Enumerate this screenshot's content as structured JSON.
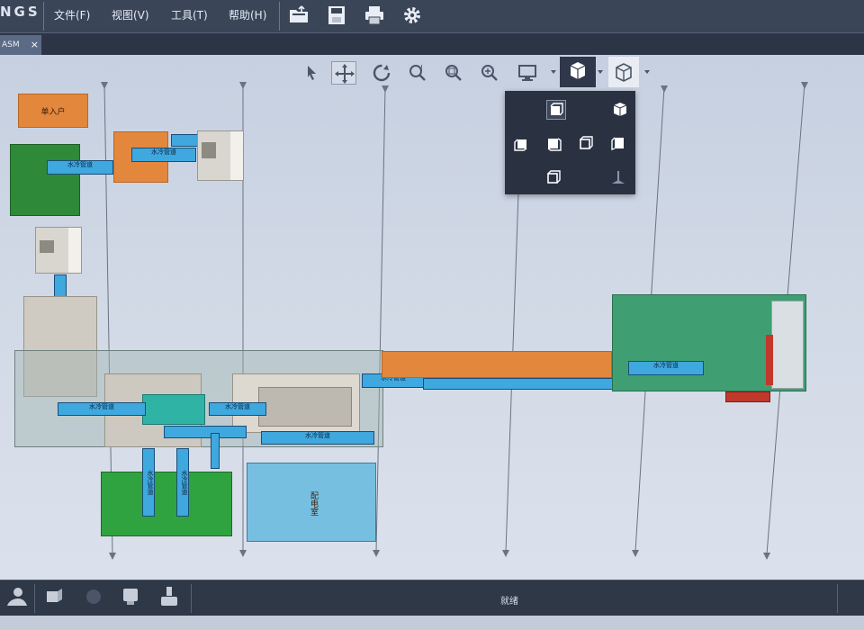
{
  "app": {
    "brand": "NGS"
  },
  "menu": {
    "items": [
      {
        "id": "file",
        "label": "文件(F)"
      },
      {
        "id": "view",
        "label": "视图(V)"
      },
      {
        "id": "tools",
        "label": "工具(T)"
      },
      {
        "id": "help",
        "label": "帮助(H)"
      }
    ]
  },
  "toolbar": {
    "icons": [
      "open-folder-icon",
      "save-icon",
      "print-icon",
      "settings-gear-icon"
    ]
  },
  "tabs": [
    {
      "label": "ASM",
      "close": "×"
    }
  ],
  "view_toolbar": {
    "icons": [
      "select-arrow-icon",
      "pan-move-icon",
      "rotate-icon",
      "zoom-window-icon",
      "zoom-fit-icon",
      "zoom-in-icon",
      "display-monitor-icon",
      "view-orientation-cube-icon",
      "view-style-cube-icon"
    ],
    "active": "pan-move-icon",
    "open_dropdown": "view-orientation-cube-icon"
  },
  "view_popup": {
    "items": [
      "view-front-icon",
      "view-iso-icon",
      "view-left-icon",
      "view-back-icon",
      "view-right-icon",
      "view-rear-icon",
      "view-bottom-icon",
      "view-perspective-icon"
    ],
    "selected": "view-front-icon"
  },
  "drawing": {
    "room_labels": {
      "entry": "单入户",
      "cyan_room": "配电室"
    },
    "pipe_label": "水冷管道"
  },
  "bottom_toolbar": {
    "icons": [
      "user-icon",
      "rotate-view-icon",
      "measure-icon",
      "layers-icon",
      "export-icon"
    ],
    "status": "就绪"
  },
  "colors": {
    "orange": "#e3873d",
    "green": "#2e8a38",
    "blue_bar": "#3fa8de",
    "cyan_room": "#76bfe0",
    "teal_green": "#3f9f73",
    "gray_panel": "#b9bfc5"
  }
}
